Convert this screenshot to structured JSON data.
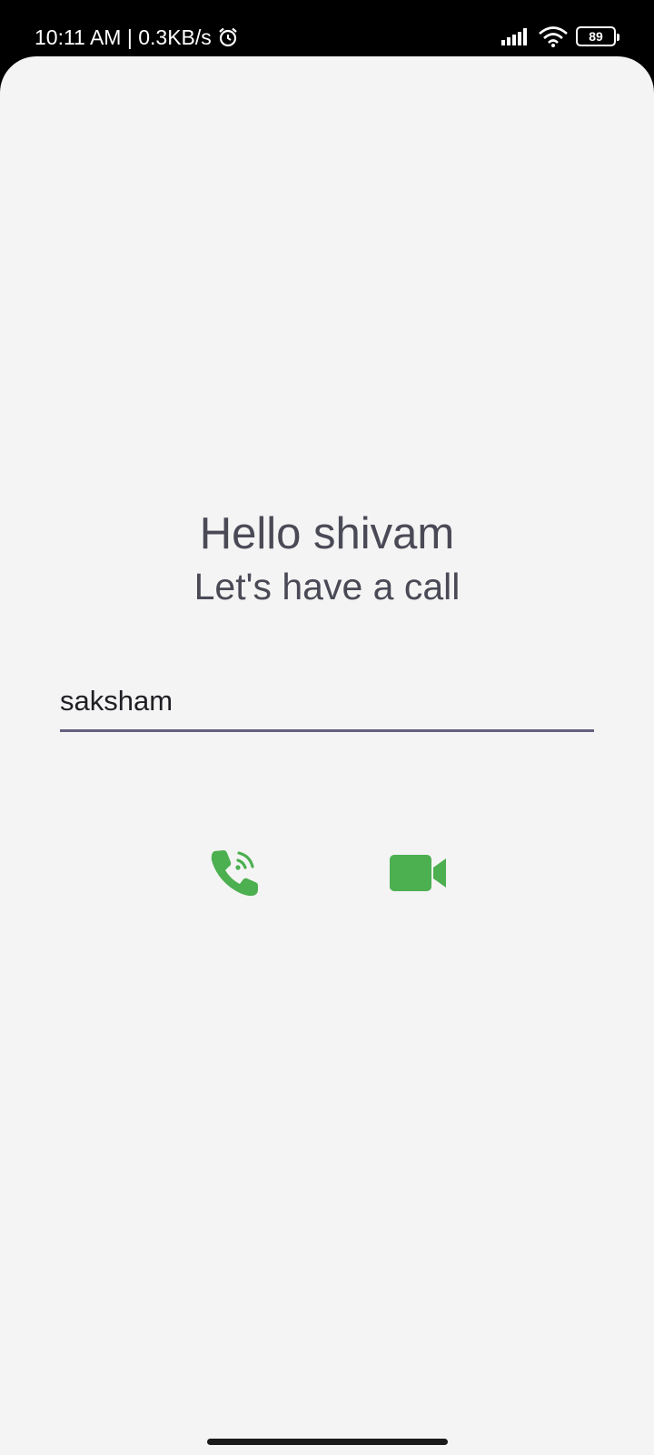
{
  "status_bar": {
    "time_speed": "10:11 AM | 0.3KB/s",
    "battery": "89",
    "icons": [
      "alarm-icon",
      "signal-icon",
      "wifi-icon",
      "battery-icon"
    ]
  },
  "main": {
    "greeting": "Hello shivam",
    "subtitle": "Let's have a call",
    "callee_input": {
      "value": "saksham",
      "placeholder": ""
    },
    "actions": [
      {
        "icon": "phone-call-icon",
        "color": "#4caf50"
      },
      {
        "icon": "video-camera-icon",
        "color": "#4caf50"
      }
    ]
  },
  "colors": {
    "background": "#f4f4f4",
    "accent_green": "#4caf50",
    "underline": "#675f7e",
    "text": "#4a4a57"
  }
}
